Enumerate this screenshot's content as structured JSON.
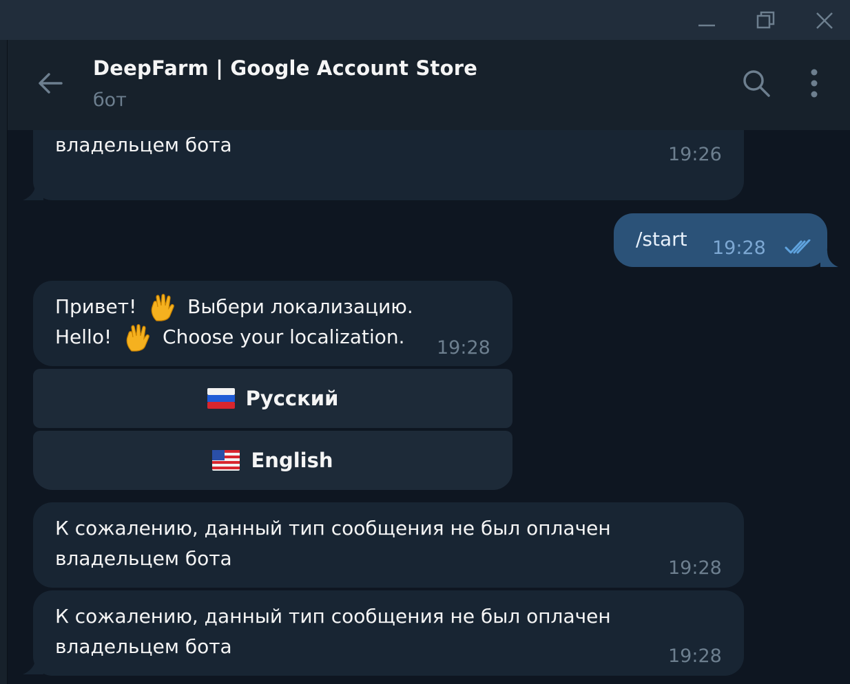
{
  "window": {
    "minimize_icon": "minimize-icon",
    "restore_icon": "restore-icon",
    "close_icon": "close-icon"
  },
  "header": {
    "title": "DeepFarm | Google Account Store",
    "subtitle": "бот",
    "back_icon": "arrow-left-icon",
    "search_icon": "search-icon",
    "more_icon": "more-vertical-icon"
  },
  "messages": [
    {
      "direction": "in",
      "text": "К сожалению, данный тип сообщения не был оплачен\nвладельцем бота",
      "time": "19:26"
    },
    {
      "direction": "out",
      "text": "/start",
      "time": "19:28",
      "status_icon": "double-check-icon"
    },
    {
      "direction": "in",
      "line1_a": "Привет!",
      "line1_b": "Выбери локализацию.",
      "line2_a": "Hello!",
      "line2_b": "Choose your localization.",
      "time": "19:28",
      "emoji_icon": "vulcan-salute-icon"
    },
    {
      "direction": "in",
      "text": "К сожалению, данный тип сообщения не был оплачен\nвладельцем бота",
      "time": "19:28"
    },
    {
      "direction": "in",
      "text": "К сожалению, данный тип сообщения не был оплачен\nвладельцем бота",
      "time": "19:28"
    }
  ],
  "keyboard": [
    {
      "label": "Русский",
      "flag_icon": "russia-flag-icon"
    },
    {
      "label": "English",
      "flag_icon": "usa-flag-icon"
    }
  ],
  "colors": {
    "background": "#0e1621",
    "bubble_in": "#182533",
    "bubble_out": "#2b5278",
    "header": "#17212b",
    "titlebar": "#212d3b",
    "accent": "#5fa3de"
  }
}
